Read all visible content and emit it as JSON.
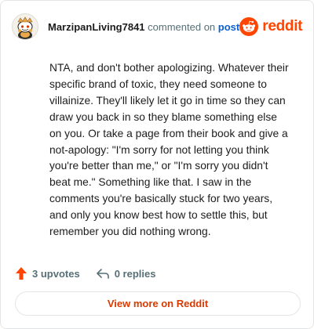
{
  "header": {
    "username": "MarzipanLiving7841",
    "commented_on_text": " commented on ",
    "post_link": "post",
    "brand_name": "reddit"
  },
  "comment": {
    "text": "NTA, and don't bother apologizing. Whatever their specific brand of toxic, they need someone to villainize. They'll likely let it go in time so they can draw you back in so they blame something else on you. Or take a page from their book and give a not-apology: \"I'm sorry for not letting you think you're better than me,\" or \"I'm sorry you didn't beat me.\" Something like that. I saw in the comments you're basically stuck for two years, and only you know best how to settle this, but remember you did nothing wrong."
  },
  "actions": {
    "upvotes_label": "3 upvotes",
    "replies_label": "0 replies"
  },
  "footer": {
    "view_more_label": "View more on Reddit"
  },
  "icons": {
    "avatar": "snoo-avatar",
    "brand": "reddit-logo-icon",
    "upvote": "upvote-arrow-icon",
    "reply": "reply-arrow-icon"
  },
  "colors": {
    "brand": "#ff4500",
    "upvote_active": "#ff4500",
    "link": "#0a5fd6",
    "view_more_text": "#d93a00",
    "muted_text": "#576f76"
  }
}
